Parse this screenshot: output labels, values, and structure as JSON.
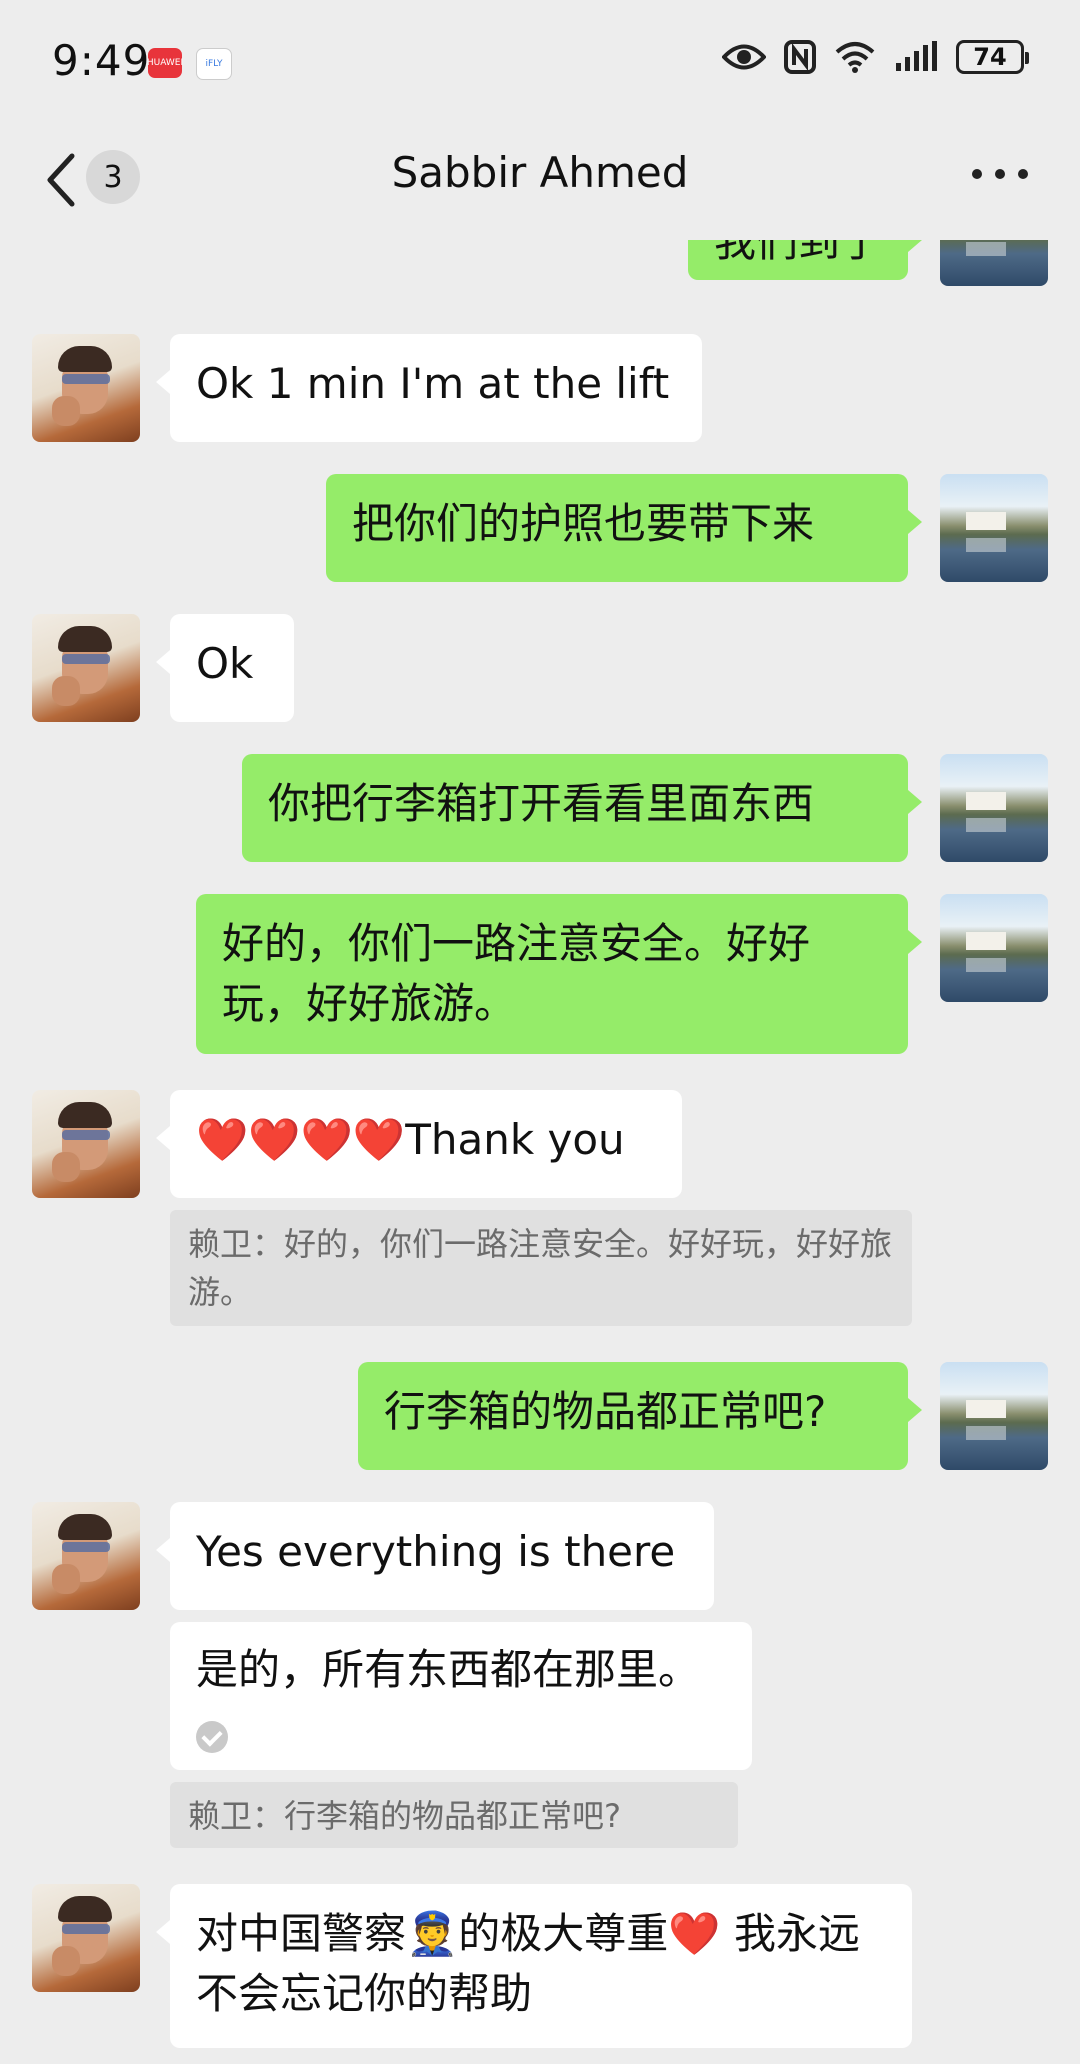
{
  "status_bar": {
    "time": "9:49",
    "app_icons": [
      "huawei-app-icon",
      "ifly-app-icon"
    ],
    "app_icon_labels": [
      "HUAWEI",
      "iFLY"
    ],
    "battery": "74"
  },
  "header": {
    "unread_count": "3",
    "contact_name": "Sabbir Ahmed"
  },
  "messages": [
    {
      "side": "out",
      "text": "我们到了"
    },
    {
      "side": "in",
      "text": "Ok 1 min I'm at the lift"
    },
    {
      "side": "out",
      "text": "把你们的护照也要带下来"
    },
    {
      "side": "in",
      "text": "Ok"
    },
    {
      "side": "out",
      "text": "你把行李箱打开看看里面东西"
    },
    {
      "side": "out",
      "text": "好的，你们一路注意安全。好好玩，好好旅游。"
    },
    {
      "side": "in",
      "hearts": "❤️❤️❤️❤️",
      "text": "Thank you",
      "quote": "赖卫：好的，你们一路注意安全。好好玩，好好旅游。"
    },
    {
      "side": "out",
      "text": "行李箱的物品都正常吧?"
    },
    {
      "side": "in",
      "text": "Yes everything is there"
    },
    {
      "side": "in",
      "text": "是的，所有东西都在那里。",
      "translated": true,
      "quote": "赖卫：行李箱的物品都正常吧?"
    },
    {
      "side": "in",
      "text": "对中国警察👮的极大尊重❤️ 我永远不会忘记你的帮助"
    }
  ],
  "colors": {
    "background": "#ededed",
    "outgoing_bubble": "#95ec69",
    "incoming_bubble": "#ffffff"
  }
}
